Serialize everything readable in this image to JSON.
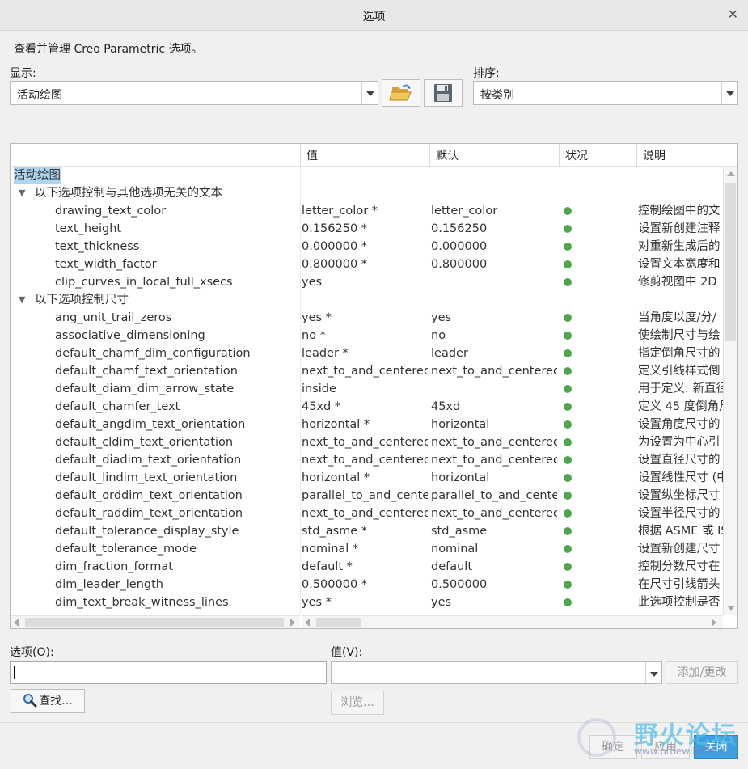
{
  "window": {
    "title": "选项"
  },
  "description": "查看并管理 Creo Parametric 选项。",
  "display": {
    "label": "显示:",
    "value": "活动绘图"
  },
  "sort": {
    "label": "排序:",
    "value": "按类别"
  },
  "icons": {
    "open": "folder-open-icon",
    "save": "save-floppy-icon",
    "search": "magnifier-icon",
    "close": "close-icon"
  },
  "table": {
    "headers": {
      "value": "值",
      "default": "默认",
      "status": "状况",
      "desc": "说明"
    },
    "root": "活动绘图",
    "groups": [
      {
        "label": "以下选项控制与其他选项无关的文本",
        "rows": [
          {
            "name": "drawing_text_color",
            "value": "letter_color *",
            "default": "letter_color",
            "desc": "控制绘图中的文"
          },
          {
            "name": "text_height",
            "value": "0.156250 *",
            "default": "0.156250",
            "desc": "设置新创建注释"
          },
          {
            "name": "text_thickness",
            "value": "0.000000 *",
            "default": "0.000000",
            "desc": "对重新生成后的"
          },
          {
            "name": "text_width_factor",
            "value": "0.800000 *",
            "default": "0.800000",
            "desc": "设置文本宽度和"
          },
          {
            "name": "clip_curves_in_local_full_xsecs",
            "value": "yes",
            "default": "",
            "desc": "修剪视图中 2D"
          }
        ]
      },
      {
        "label": "以下选项控制尺寸",
        "rows": [
          {
            "name": "ang_unit_trail_zeros",
            "value": "yes *",
            "default": "yes",
            "desc": "当角度以度/分/"
          },
          {
            "name": "associative_dimensioning",
            "value": "no *",
            "default": "no",
            "desc": "使绘制尺寸与绘"
          },
          {
            "name": "default_chamf_dim_configuration",
            "value": "leader *",
            "default": "leader",
            "desc": "指定倒角尺寸的"
          },
          {
            "name": "default_chamf_text_orientation",
            "value": "next_to_and_centered",
            "default": "next_to_and_centered",
            "desc": "定义引线样式倒"
          },
          {
            "name": "default_diam_dim_arrow_state",
            "value": "inside",
            "default": "",
            "desc": "用于定义: 新直径"
          },
          {
            "name": "default_chamfer_text",
            "value": "45xd *",
            "default": "45xd",
            "desc": "定义 45 度倒角尺"
          },
          {
            "name": "default_angdim_text_orientation",
            "value": "horizontal *",
            "default": "horizontal",
            "desc": "设置角度尺寸的"
          },
          {
            "name": "default_cldim_text_orientation",
            "value": "next_to_and_centered",
            "default": "next_to_and_centered",
            "desc": "为设置为中心引"
          },
          {
            "name": "default_diadim_text_orientation",
            "value": "next_to_and_centered",
            "default": "next_to_and_centered",
            "desc": "设置直径尺寸的"
          },
          {
            "name": "default_lindim_text_orientation",
            "value": "horizontal *",
            "default": "horizontal",
            "desc": "设置线性尺寸 (中"
          },
          {
            "name": "default_orddim_text_orientation",
            "value": "parallel_to_and_centered",
            "default": "parallel_to_and_centered",
            "desc": "设置纵坐标尺寸"
          },
          {
            "name": "default_raddim_text_orientation",
            "value": "next_to_and_centered",
            "default": "next_to_and_centered",
            "desc": "设置半径尺寸的"
          },
          {
            "name": "default_tolerance_display_style",
            "value": "std_asme *",
            "default": "std_asme",
            "desc": "根据 ASME 或 ISO"
          },
          {
            "name": "default_tolerance_mode",
            "value": "nominal *",
            "default": "nominal",
            "desc": "设置新创建尺寸"
          },
          {
            "name": "dim_fraction_format",
            "value": "default *",
            "default": "default",
            "desc": "控制分数尺寸在"
          },
          {
            "name": "dim_leader_length",
            "value": "0.500000 *",
            "default": "0.500000",
            "desc": "在尺寸引线箭头"
          },
          {
            "name": "dim_text_break_witness_lines",
            "value": "yes *",
            "default": "yes",
            "desc": "此选项控制是否"
          }
        ]
      }
    ]
  },
  "option_field": {
    "label": "选项(O):",
    "value": ""
  },
  "value_field": {
    "label": "值(V):",
    "value": ""
  },
  "buttons": {
    "add_change": "添加/更改",
    "find": "查找...",
    "browse": "浏览...",
    "ok": "确定",
    "apply": "应用",
    "close": "关闭"
  },
  "watermark": {
    "text": "野火论坛",
    "url": "www.proewildfire.cn"
  },
  "colors": {
    "status_ok": "#4fa64f",
    "selection": "#aed6f1",
    "accent": "#3f9fe0"
  }
}
